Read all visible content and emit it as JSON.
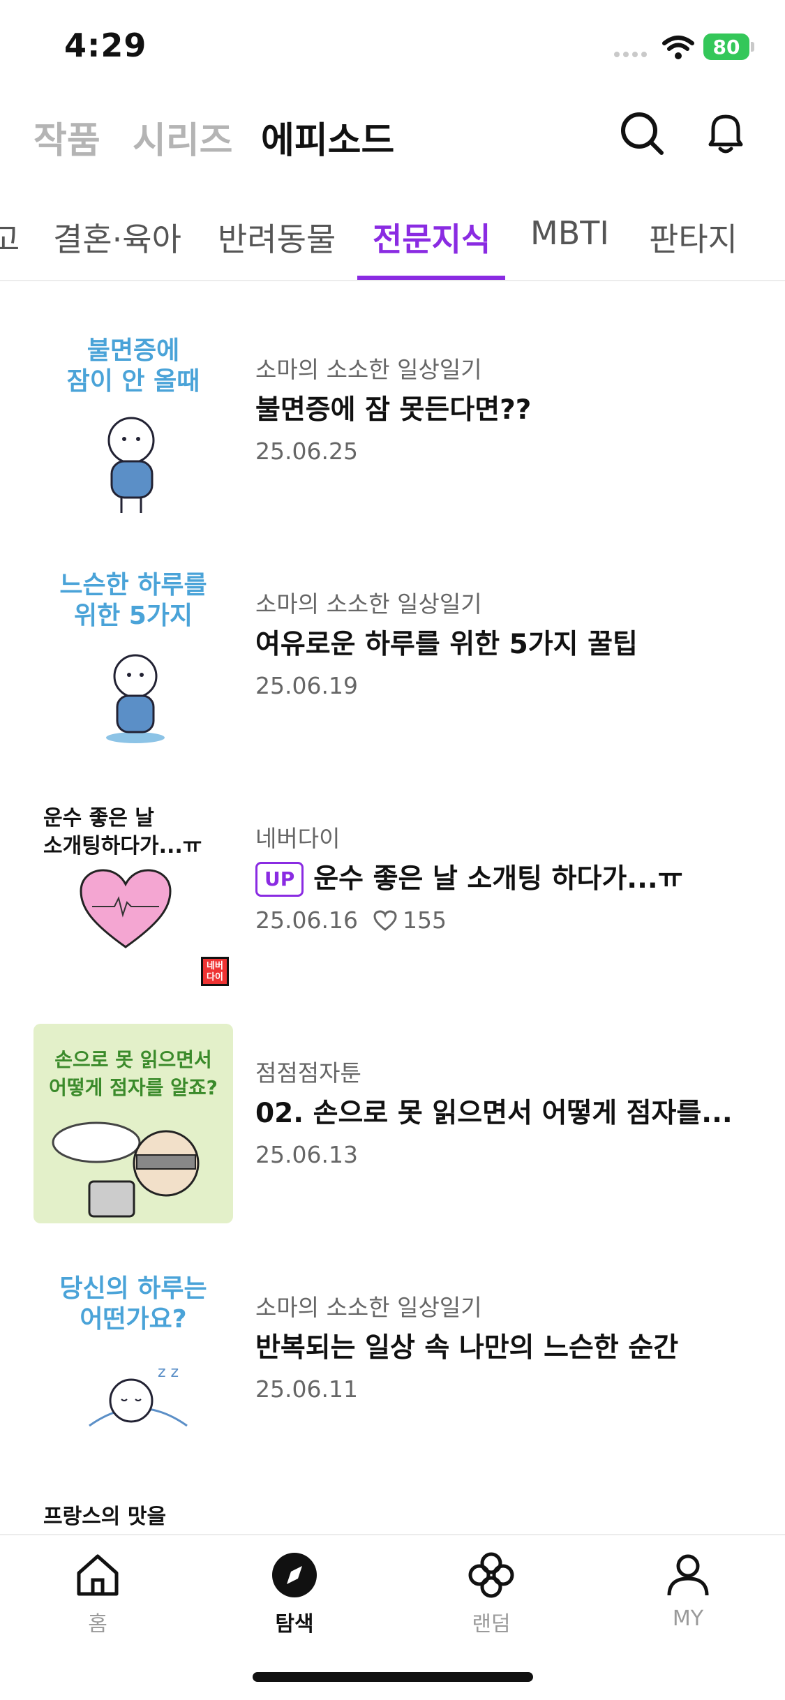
{
  "status_bar": {
    "time": "4:29",
    "battery": "80"
  },
  "header": {
    "tabs": [
      "작품",
      "시리즈",
      "에피소드"
    ],
    "active_tab": "에피소드"
  },
  "category_tabs": {
    "items": [
      "고",
      "결혼·육아",
      "반려동물",
      "전문지식",
      "MBTI",
      "판타지"
    ],
    "active": "전문지식",
    "accent_color": "#8a2be2"
  },
  "episodes": [
    {
      "thumb_text": "불면증에\n잠이 안 올때",
      "series": "소마의 소소한 일상일기",
      "title": "불면증에 잠 못든다면??",
      "date": "25.06.25"
    },
    {
      "thumb_text": "느슨한 하루를\n위한 5가지",
      "series": "소마의 소소한 일상일기",
      "title": "여유로운 하루를 위한 5가지 꿀팁",
      "date": "25.06.19"
    },
    {
      "thumb_text": "운수 좋은 날\n소개팅하다가...ㅠ",
      "series": "네버다이",
      "badge": "UP",
      "title": "운수 좋은 날 소개팅 하다가...ㅠ",
      "date": "25.06.16",
      "likes": "155",
      "stamp": "네버다이"
    },
    {
      "thumb_text": "손으로 못 읽으면서\n어떻게 점자를 알죠?",
      "series": "점점점자툰",
      "title": "02. 손으로 못 읽으면서 어떻게 점자를...",
      "date": "25.06.13"
    },
    {
      "thumb_text": "당신의 하루는\n어떤가요?",
      "series": "소마의 소소한 일상일기",
      "title": "반복되는 일상 속 나만의 느슨한 순간",
      "date": "25.06.11"
    }
  ],
  "peek_item": {
    "thumb_text": "프랑스의 맛을"
  },
  "bottom_nav": {
    "items": [
      {
        "label": "홈",
        "icon": "home-icon"
      },
      {
        "label": "탐색",
        "icon": "compass-icon"
      },
      {
        "label": "랜덤",
        "icon": "clover-icon"
      },
      {
        "label": "MY",
        "icon": "person-icon"
      }
    ],
    "active": "탐색"
  }
}
